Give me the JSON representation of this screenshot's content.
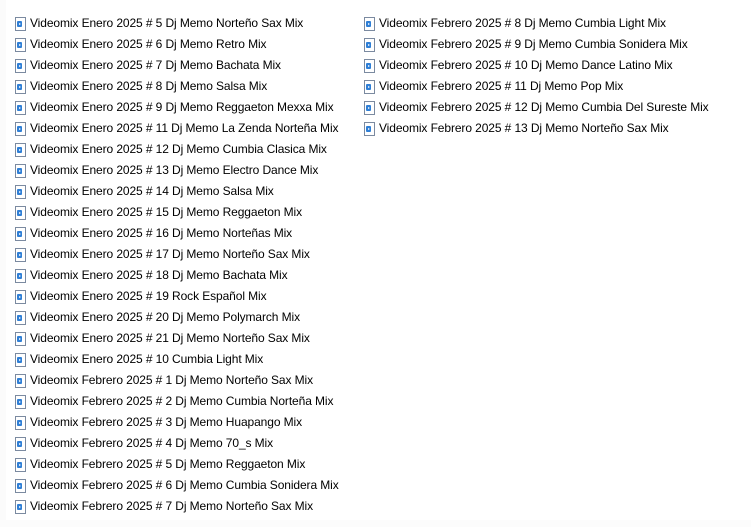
{
  "file_icon": "video-file-icon",
  "columns": [
    {
      "files": [
        "Videomix Enero 2025  # 5  Dj Memo Norteño Sax Mix",
        "Videomix Enero 2025  # 6  Dj Memo Retro Mix",
        "Videomix Enero 2025  # 7   Dj Memo Bachata Mix",
        "Videomix Enero 2025  # 8   Dj Memo Salsa Mix",
        "Videomix Enero 2025  # 9   Dj Memo Reggaeton Mexxa Mix",
        "Videomix Enero 2025  # 11 Dj Memo La Zenda Norteña Mix",
        "Videomix Enero 2025  # 12  Dj Memo Cumbia Clasica Mix",
        "Videomix Enero 2025  # 13  Dj Memo Electro Dance Mix",
        "Videomix Enero 2025  # 14  Dj Memo Salsa Mix",
        "Videomix Enero 2025  # 15  Dj Memo Reggaeton Mix",
        "Videomix Enero 2025  # 16  Dj Memo Norteñas Mix",
        "Videomix Enero 2025  # 17  Dj Memo Norteño Sax Mix",
        "Videomix Enero 2025  # 18  Dj Memo Bachata Mix",
        "Videomix Enero 2025  # 19 Rock Español Mix",
        "Videomix Enero 2025  # 20 Dj Memo Polymarch Mix",
        "Videomix Enero 2025  # 21  Dj Memo Norteño Sax Mix",
        "Videomix Enero 2025 # 10 Cumbia Light Mix",
        "Videomix Febrero 2025  # 1 Dj Memo Norteño Sax Mix",
        "Videomix Febrero 2025  # 2 Dj Memo Cumbia Norteña Mix",
        "Videomix Febrero 2025  # 3 Dj Memo Huapango Mix",
        "Videomix Febrero 2025  # 4 Dj Memo 70_s Mix",
        "Videomix Febrero 2025  # 5 Dj Memo Reggaeton Mix",
        "Videomix Febrero 2025  # 6 Dj Memo Cumbia Sonidera Mix",
        "Videomix Febrero 2025  # 7 Dj Memo Norteño Sax Mix"
      ]
    },
    {
      "files": [
        "Videomix Febrero 2025  # 8 Dj Memo Cumbia Light Mix",
        "Videomix Febrero 2025  # 9 Dj Memo Cumbia Sonidera Mix",
        "Videomix Febrero 2025  # 10 Dj Memo Dance Latino Mix",
        "Videomix Febrero 2025  # 11 Dj Memo Pop Mix",
        "Videomix Febrero 2025  # 12 Dj Memo Cumbia Del Sureste Mix",
        "Videomix Febrero 2025  # 13 Dj Memo Norteño Sax Mix"
      ]
    }
  ]
}
